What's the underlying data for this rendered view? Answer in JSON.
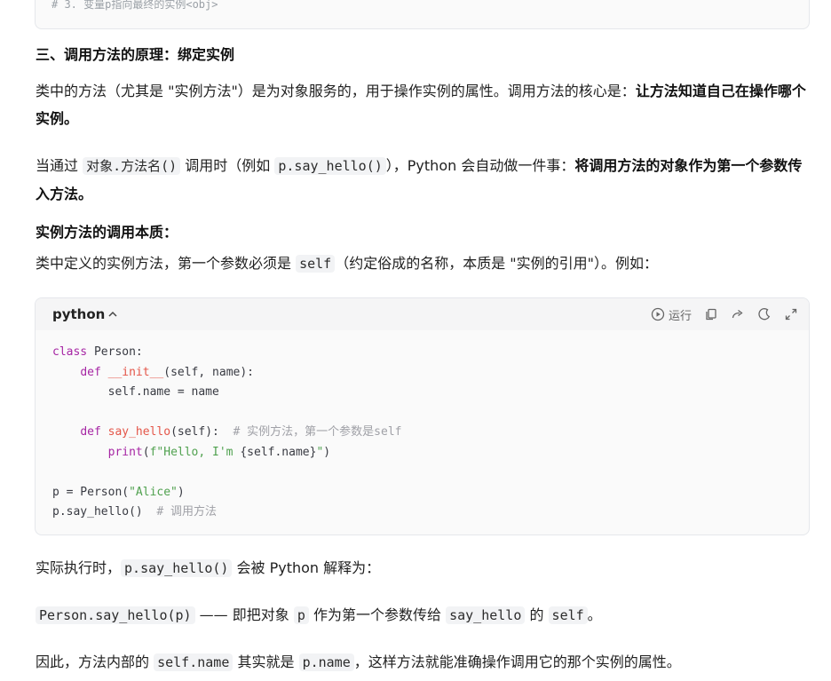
{
  "prev_code": {
    "last_line": "# 3. 变量p指向最终的实例<obj>"
  },
  "section_title": "三、调用方法的原理：绑定实例",
  "para1": {
    "text": "类中的方法（尤其是 \"实例方法\"）是为对象服务的，用于操作实例的属性。调用方法的核心是：",
    "bold": "让方法知道自己在操作哪个实例。"
  },
  "para2": {
    "t1": "当通过 ",
    "c1": "对象.方法名()",
    "t2": " 调用时（例如 ",
    "c2": "p.say_hello()",
    "t3": "），Python 会自动做一件事：",
    "bold": "将调用方法的对象作为第一个参数传入方法。"
  },
  "label": "实例方法的调用本质：",
  "para3": {
    "t1": "类中定义的实例方法，第一个参数必须是 ",
    "c1": "self",
    "t2": "（约定俗成的名称，本质是 \"实例的引用\"）。例如："
  },
  "code_block": {
    "language": "python",
    "run_label": "运行",
    "lines": [
      [
        {
          "k": "kw",
          "t": "class"
        },
        {
          "k": "",
          "t": " Person:"
        }
      ],
      [
        {
          "k": "",
          "t": "    "
        },
        {
          "k": "kw",
          "t": "def"
        },
        {
          "k": "",
          "t": " "
        },
        {
          "k": "fn",
          "t": "__init__"
        },
        {
          "k": "",
          "t": "(self, name):"
        }
      ],
      [
        {
          "k": "",
          "t": "        self.name = name"
        }
      ],
      [],
      [
        {
          "k": "",
          "t": "    "
        },
        {
          "k": "kw",
          "t": "def"
        },
        {
          "k": "",
          "t": " "
        },
        {
          "k": "fn",
          "t": "say_hello"
        },
        {
          "k": "",
          "t": "(self):  "
        },
        {
          "k": "cm",
          "t": "# 实例方法，第一个参数是self"
        }
      ],
      [
        {
          "k": "",
          "t": "        "
        },
        {
          "k": "kw",
          "t": "print"
        },
        {
          "k": "",
          "t": "("
        },
        {
          "k": "str",
          "t": "f\"Hello, I'm "
        },
        {
          "k": "",
          "t": "{self.name}"
        },
        {
          "k": "str",
          "t": "\""
        },
        {
          "k": "",
          "t": ")"
        }
      ],
      [],
      [
        {
          "k": "",
          "t": "p = Person("
        },
        {
          "k": "str",
          "t": "\"Alice\""
        },
        {
          "k": "",
          "t": ")"
        }
      ],
      [
        {
          "k": "",
          "t": "p.say_hello()  "
        },
        {
          "k": "cm",
          "t": "# 调用方法"
        }
      ]
    ]
  },
  "para4": {
    "t1": "实际执行时，",
    "c1": "p.say_hello()",
    "t2": " 会被 Python 解释为："
  },
  "para5": {
    "c1": "Person.say_hello(p)",
    "t1": " —— 即把对象 ",
    "c2": "p",
    "t2": " 作为第一个参数传给 ",
    "c3": "say_hello",
    "t3": " 的 ",
    "c4": "self",
    "t4": "。"
  },
  "para6": {
    "t1": "因此，方法内部的 ",
    "c1": "self.name",
    "t2": " 其实就是 ",
    "c2": "p.name",
    "t3": "，这样方法就能准确操作调用它的那个实例的属性。"
  }
}
